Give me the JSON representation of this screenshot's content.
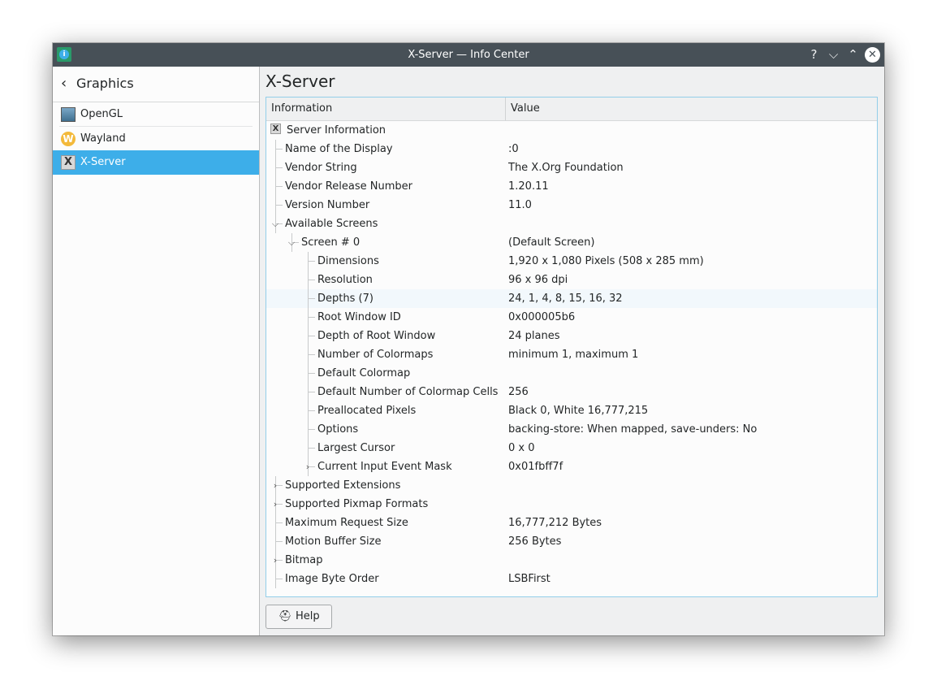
{
  "window": {
    "title": "X-Server — Info Center",
    "app_icon_glyph": "i",
    "buttons": {
      "help": "?",
      "minimize": "⌵",
      "maximize": "⌃",
      "close": "✕"
    }
  },
  "sidebar": {
    "back_label": "Graphics",
    "items": [
      {
        "label": "OpenGL",
        "icon": "opengl-icon",
        "selected": false
      },
      {
        "label": "Wayland",
        "icon": "wayland-icon",
        "icon_glyph": "W",
        "selected": false
      },
      {
        "label": "X-Server",
        "icon": "xserver-icon",
        "icon_glyph": "X",
        "selected": true
      }
    ]
  },
  "page_title": "X-Server",
  "tree": {
    "columns": [
      "Information",
      "Value"
    ],
    "rows": [
      {
        "label": "Server Information",
        "value": "",
        "depth": 0,
        "icon": true
      },
      {
        "label": "Name of the Display",
        "value": ":0",
        "depth": 1
      },
      {
        "label": "Vendor String",
        "value": "The X.Org Foundation",
        "depth": 1
      },
      {
        "label": "Vendor Release Number",
        "value": "1.20.11",
        "depth": 1
      },
      {
        "label": "Version Number",
        "value": "11.0",
        "depth": 1
      },
      {
        "label": "Available Screens",
        "value": "",
        "depth": 1,
        "expander": "expanded"
      },
      {
        "label": "Screen # 0",
        "value": "(Default Screen)",
        "depth": 2,
        "expander": "expanded"
      },
      {
        "label": "Dimensions",
        "value": "1,920 x 1,080 Pixels (508 x 285 mm)",
        "depth": 3
      },
      {
        "label": "Resolution",
        "value": "96 x 96 dpi",
        "depth": 3
      },
      {
        "label": "Depths (7)",
        "value": "24, 1, 4, 8, 15, 16, 32",
        "depth": 3,
        "highlighted": true
      },
      {
        "label": "Root Window ID",
        "value": "0x000005b6",
        "depth": 3
      },
      {
        "label": "Depth of Root Window",
        "value": "24 planes",
        "depth": 3
      },
      {
        "label": "Number of Colormaps",
        "value": "minimum 1, maximum 1",
        "depth": 3
      },
      {
        "label": "Default Colormap",
        "value": "",
        "depth": 3
      },
      {
        "label": "Default Number of Colormap Cells",
        "value": "256",
        "depth": 3
      },
      {
        "label": "Preallocated Pixels",
        "value": "Black 0, White 16,777,215",
        "depth": 3
      },
      {
        "label": "Options",
        "value": "backing-store: When mapped, save-unders: No",
        "depth": 3
      },
      {
        "label": "Largest Cursor",
        "value": "0 x 0",
        "depth": 3
      },
      {
        "label": "Current Input Event Mask",
        "value": "0x01fbff7f",
        "depth": 3,
        "expander": "collapsed"
      },
      {
        "label": "Supported Extensions",
        "value": "",
        "depth": 1,
        "expander": "collapsed"
      },
      {
        "label": "Supported Pixmap Formats",
        "value": "",
        "depth": 1,
        "expander": "collapsed"
      },
      {
        "label": "Maximum Request Size",
        "value": "16,777,212 Bytes",
        "depth": 1
      },
      {
        "label": "Motion Buffer Size",
        "value": "256 Bytes",
        "depth": 1
      },
      {
        "label": "Bitmap",
        "value": "",
        "depth": 1,
        "expander": "collapsed"
      },
      {
        "label": "Image Byte Order",
        "value": "LSBFirst",
        "depth": 1
      }
    ]
  },
  "help_button": {
    "label": "Help",
    "icon": "lifebuoy-icon",
    "icon_glyph": "⛑"
  },
  "colors": {
    "accent": "#3daee9",
    "titlebar": "#475057",
    "frame_border": "#93cee9"
  }
}
